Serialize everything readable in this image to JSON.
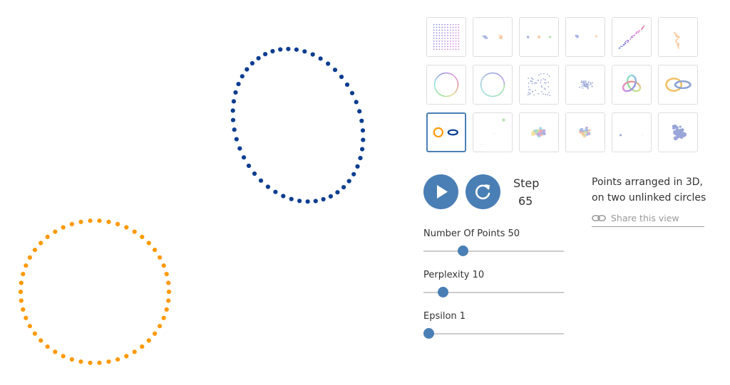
{
  "step": {
    "label": "Step",
    "value": "65"
  },
  "description": {
    "line1": "Points arranged in 3D,",
    "line2": "on two unlinked circles"
  },
  "share": {
    "label": "Share this view",
    "icon": "link-icon"
  },
  "sliders": [
    {
      "label": "Number Of Points",
      "value": "50",
      "fraction": 0.26
    },
    {
      "label": "Perplexity",
      "value": "10",
      "fraction": 0.11
    },
    {
      "label": "Epsilon",
      "value": "1",
      "fraction": 0.0
    }
  ],
  "controls": {
    "play_icon": "play-icon",
    "reset_icon": "refresh-icon"
  },
  "colors": {
    "accent": "#4a7fb5",
    "circle_a": "#ff9900",
    "circle_b": "#0b3d91"
  },
  "thumbnails": [
    "grid",
    "two-clusters",
    "three-clusters",
    "two-different-clusters",
    "long-linear-strip",
    "random-walk",
    "circle",
    "gradient-circle",
    "random-cloud-a",
    "gaussian-cloud",
    "trefoil-knot",
    "linked-rings",
    "unlinked-circles",
    "sparse-points",
    "multi-color-cluster",
    "color-blob",
    "few-points",
    "varied-size-cloud"
  ],
  "selected_thumbnail": 12
}
